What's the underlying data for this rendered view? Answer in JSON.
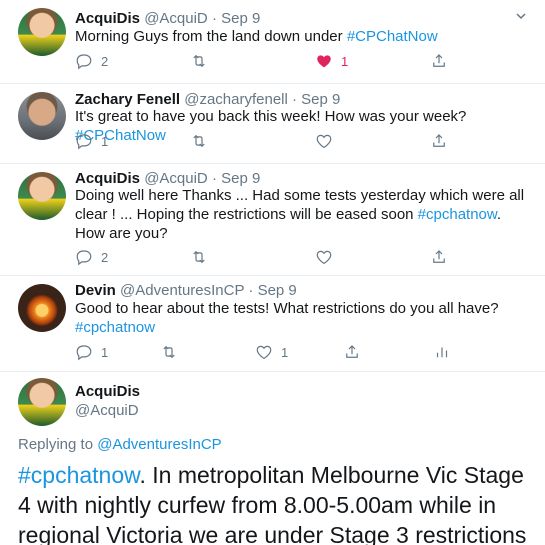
{
  "tweets": [
    {
      "name": "AcquiDis",
      "handle": "@AcquiD",
      "dot": "·",
      "date": "Sep 9",
      "text_pre": "Morning Guys from the land down under ",
      "hashtag": "#CPChatNow",
      "text_post": "",
      "reply_count": "2",
      "retweet_count": "",
      "like_count": "1",
      "liked": true
    },
    {
      "name": "Zachary Fenell",
      "handle": "@zacharyfenell",
      "dot": "·",
      "date": "Sep 9",
      "text_pre": "It's great to have you back this week! How was your week? ",
      "hashtag": "#CPChatNow",
      "text_post": "",
      "reply_count": "1",
      "retweet_count": "",
      "like_count": ""
    },
    {
      "name": "AcquiDis",
      "handle": "@AcquiD",
      "dot": "·",
      "date": "Sep 9",
      "text_pre": "Doing well here Thanks ... Had some tests yesterday which were all clear ! ... Hoping the restrictions will be eased soon ",
      "hashtag": "#cpchatnow",
      "text_post": ". How are you?",
      "reply_count": "2",
      "retweet_count": "",
      "like_count": ""
    },
    {
      "name": "Devin",
      "handle": "@AdventuresInCP",
      "dot": "·",
      "date": "Sep 9",
      "text_pre": "Good to hear about the tests! What restrictions do you all have? ",
      "hashtag": "#cpchatnow",
      "text_post": "",
      "reply_count": "1",
      "retweet_count": "",
      "like_count": "1"
    }
  ],
  "main": {
    "name": "AcquiDis",
    "handle": "@AcquiD",
    "replying_prefix": "Replying to ",
    "replying_to": "@AdventuresInCP",
    "hashtag": "#cpchatnow",
    "text": ". In metropolitan Melbourne Vic Stage 4 with nightly curfew from 8.00-5.00am while in regional Victoria we are under Stage 3 restrictions"
  },
  "colors": {
    "accent": "#1b95e0",
    "like": "#e0245e",
    "muted": "#657786",
    "divider": "#e6ecf0"
  },
  "icons": {
    "reply": "reply-icon",
    "retweet": "retweet-icon",
    "like": "heart-icon",
    "share": "share-icon",
    "analytics": "analytics-icon",
    "menu": "chevron-down-icon"
  }
}
